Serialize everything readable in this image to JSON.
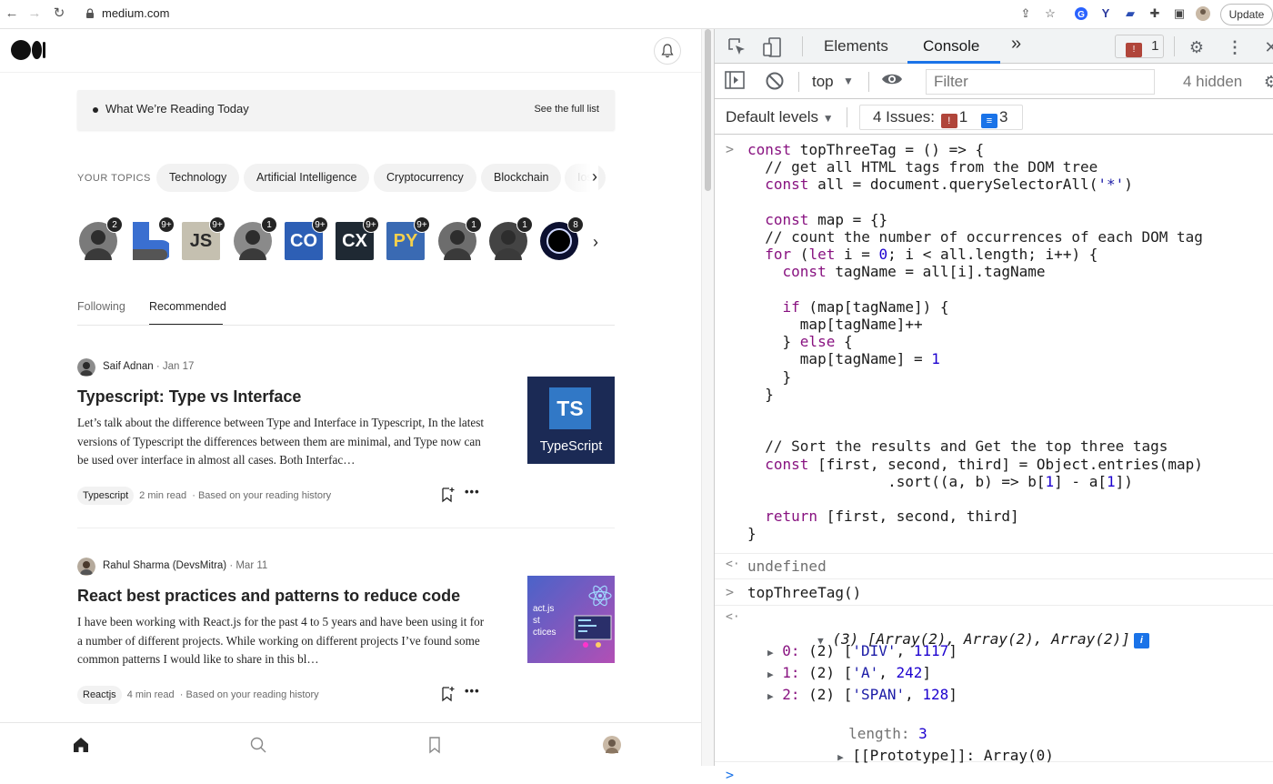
{
  "browser": {
    "url": "medium.com",
    "update_label": "Update"
  },
  "medium": {
    "reading_today": {
      "title": "What We’re Reading Today",
      "link": "See the full list"
    },
    "topics_label": "YOUR TOPICS",
    "topics": [
      "Technology",
      "Artificial Intelligence",
      "Cryptocurrency",
      "Blockchain",
      "Ios"
    ],
    "avatars": [
      {
        "badge": "2",
        "kind": "person",
        "color": "#7a7a7a"
      },
      {
        "badge": "9+",
        "kind": "shape-blue",
        "color": "#3a6fd0"
      },
      {
        "badge": "9+",
        "kind": "text",
        "text": "JS",
        "color": "#c5c0b0"
      },
      {
        "badge": "1",
        "kind": "person",
        "color": "#8a8a8a"
      },
      {
        "badge": "9+",
        "kind": "logo",
        "text": "CO",
        "color": "#2d5fb5"
      },
      {
        "badge": "9+",
        "kind": "logo-dark",
        "text": "CX",
        "color": "#1f2933"
      },
      {
        "badge": "9+",
        "kind": "text",
        "text": "PY",
        "color": "#3a6ab3"
      },
      {
        "badge": "1",
        "kind": "person",
        "color": "#6d6d6d"
      },
      {
        "badge": "1",
        "kind": "person",
        "color": "#444"
      },
      {
        "badge": "8",
        "kind": "eclipse",
        "color": "#0c1030"
      }
    ],
    "tabs": {
      "following": "Following",
      "recommended": "Recommended"
    },
    "articles": [
      {
        "author": "Saif Adnan",
        "date": " · Jan 17",
        "title": "Typescript: Type vs Interface",
        "snippet": "Let’s talk about the difference between Type and Interface in Typescript, In the latest versions of Typescript the differences between them are minimal, and Type now can be used over interface in almost all cases. Both Interfac…",
        "tag": "Typescript",
        "read_time": "2 min read",
        "reason": "· Based on your reading history",
        "thumb_main": "TS",
        "thumb_sub": "TypeScript"
      },
      {
        "author": "Rahul Sharma (DevsMitra)",
        "date": " · Mar 11",
        "title": "React best practices and patterns to reduce code",
        "snippet": "I have been working with React.js for the past 4 to 5 years and have been using it for a number of different projects. While working on different projects I’ve found some common patterns I would like to share in this bl…",
        "tag": "Reactjs",
        "read_time": "4 min read",
        "reason": "· Based on your reading history",
        "thumb_text": "act.js\nst\nctices"
      }
    ]
  },
  "devtools": {
    "tabs": [
      "Elements",
      "Console"
    ],
    "more_tabs": "»",
    "issue_count_top": "1",
    "context": "top",
    "filter_placeholder": "Filter",
    "hidden": "4 hidden",
    "levels": "Default levels",
    "issues_label": "4 Issues:",
    "issues_warn": "1",
    "issues_info": "3",
    "code_lines": [
      "const topThreeTag = () => {",
      "  // get all HTML tags from the DOM tree",
      "  const all = document.querySelectorAll('*')",
      "",
      "  const map = {}",
      "  // count the number of occurrences of each DOM tag",
      "  for (let i = 0; i < all.length; i++) {",
      "    const tagName = all[i].tagName",
      "",
      "    if (map[tagName]) {",
      "      map[tagName]++",
      "    } else {",
      "      map[tagName] = 1",
      "    }",
      "  }",
      "",
      "",
      "  // Sort the results and Get the top three tags",
      "  const [first, second, third] = Object.entries(map)",
      "                .sort((a, b) => b[1] - a[1])",
      "",
      "  return [first, second, third]",
      "}"
    ],
    "result_undefined": "undefined",
    "call": "topThreeTag()",
    "array_summary": "(3) [Array(2), Array(2), Array(2)]",
    "array_items": [
      {
        "key": "0:",
        "value": "(2) ['DIV', 1117]"
      },
      {
        "key": "1:",
        "value": "(2) ['A', 242]"
      },
      {
        "key": "2:",
        "value": "(2) ['SPAN', 128]"
      }
    ],
    "length_key": "length:",
    "length_value": "3",
    "prototype": "[[Prototype]]: Array(0)"
  }
}
